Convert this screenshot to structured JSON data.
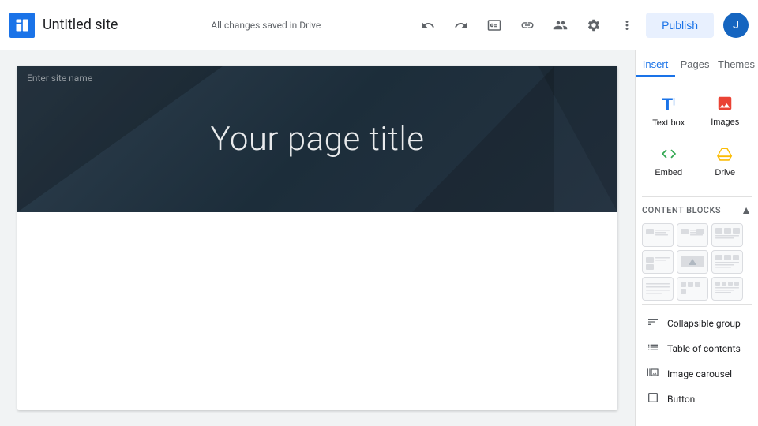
{
  "topbar": {
    "logo_alt": "Google Sites logo",
    "site_title": "Untitled site",
    "save_status": "All changes saved in Drive",
    "publish_label": "Publish",
    "avatar_initial": "J"
  },
  "toolbar": {
    "undo_icon": "↩",
    "redo_icon": "↪",
    "preview_icon": "⬜",
    "link_icon": "🔗",
    "people_icon": "👥",
    "settings_icon": "⚙",
    "more_icon": "⋮"
  },
  "canvas": {
    "enter_site_name": "Enter site name",
    "page_title": "Your page title"
  },
  "right_panel": {
    "tabs": [
      {
        "id": "insert",
        "label": "Insert",
        "active": true
      },
      {
        "id": "pages",
        "label": "Pages",
        "active": false
      },
      {
        "id": "themes",
        "label": "Themes",
        "active": false
      }
    ],
    "insert_tools": [
      {
        "id": "text-box",
        "label": "Text box",
        "icon": "T",
        "color": "#1a73e8"
      },
      {
        "id": "images",
        "label": "Images",
        "icon": "🖼",
        "color": "#ea4335"
      },
      {
        "id": "embed",
        "label": "Embed",
        "icon": "</>",
        "color": "#34a853"
      },
      {
        "id": "drive",
        "label": "Drive",
        "icon": "△",
        "color": "#fbbc04"
      }
    ],
    "content_blocks_label": "CONTENT BLOCKS",
    "special_items": [
      {
        "id": "collapsible-group",
        "label": "Collapsible group",
        "icon": "☰"
      },
      {
        "id": "table-of-contents",
        "label": "Table of contents",
        "icon": "≡"
      },
      {
        "id": "image-carousel",
        "label": "Image carousel",
        "icon": "◫"
      },
      {
        "id": "button",
        "label": "Button",
        "icon": "⬜"
      }
    ]
  }
}
